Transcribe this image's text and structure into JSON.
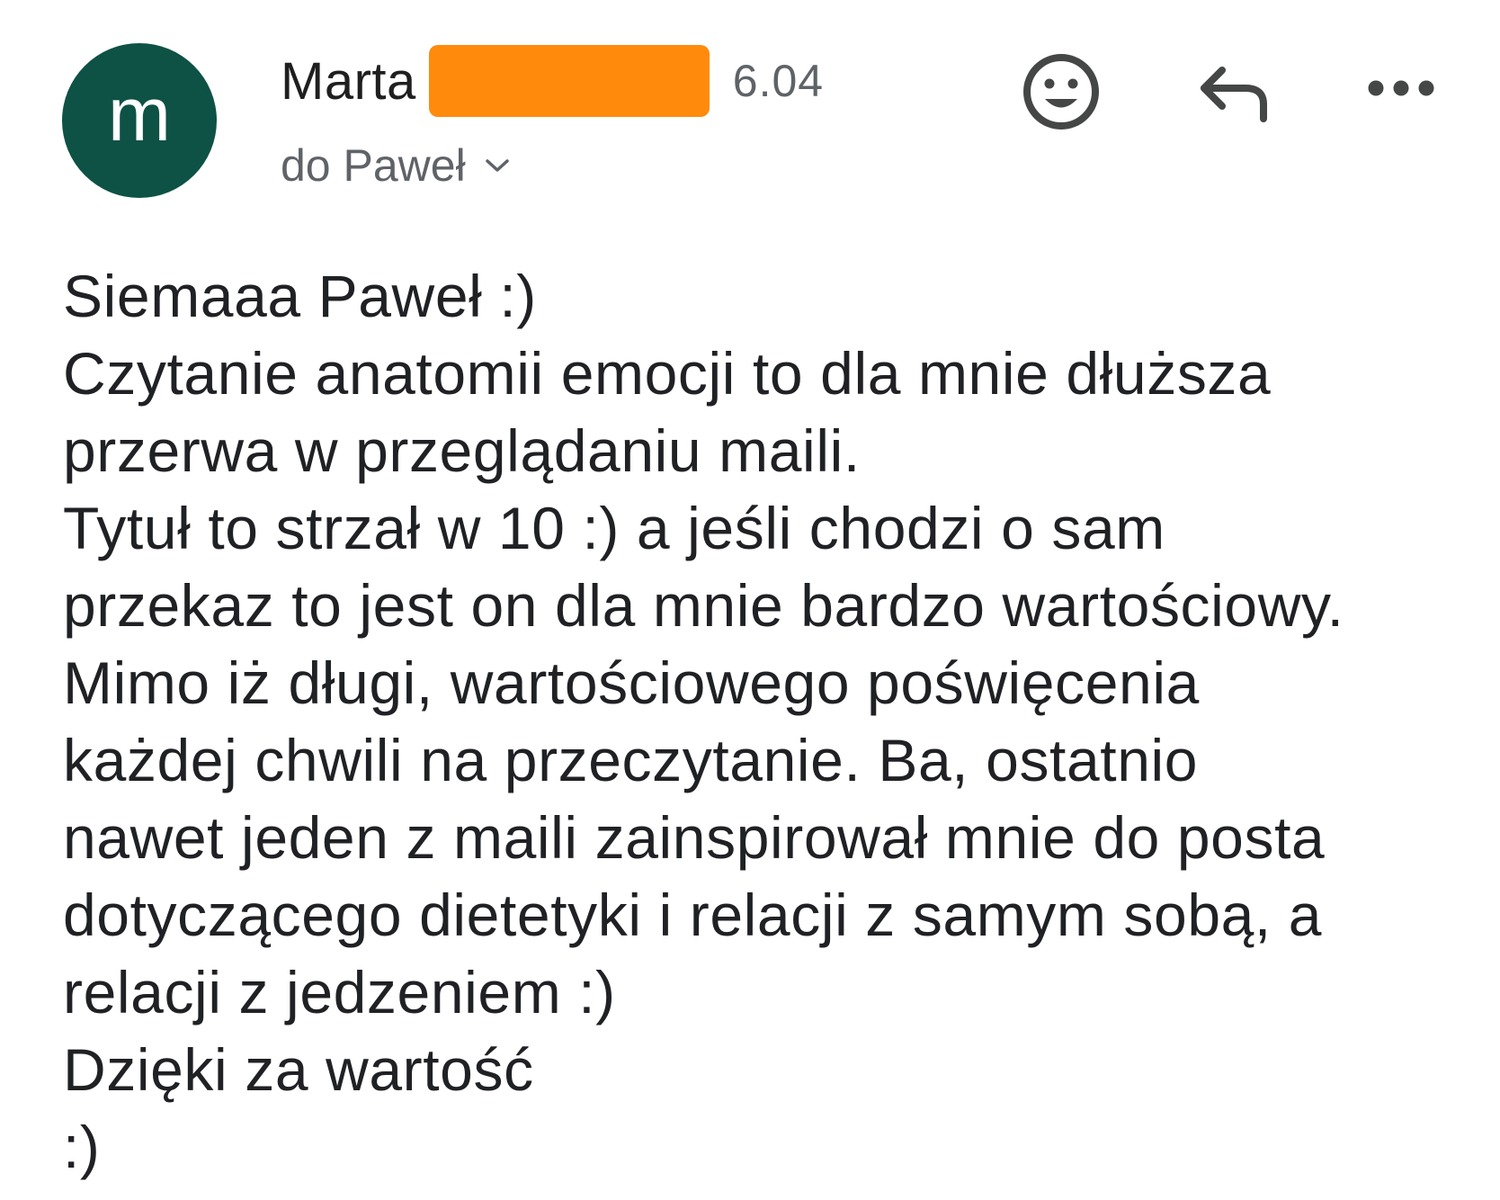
{
  "header": {
    "avatar_letter": "m",
    "avatar_color": "#0e5245",
    "sender_name": "Marta",
    "redaction_color": "#ff8a0c",
    "date": "6.04",
    "recipient_label": "do Paweł",
    "actions": [
      {
        "icon": "smiley-icon"
      },
      {
        "icon": "reply-icon"
      },
      {
        "icon": "more-horizontal-icon"
      }
    ]
  },
  "body": {
    "lines": [
      "Siemaaa Paweł :)",
      "Czytanie anatomii emocji to dla mnie dłuższa",
      "przerwa w przeglądaniu maili.",
      "Tytuł to strzał w 10 :) a jeśli chodzi o sam",
      "przekaz to jest on dla mnie bardzo wartościowy.",
      "Mimo iż długi, wartościowego poświęcenia",
      "każdej chwili na przeczytanie. Ba, ostatnio",
      "nawet jeden z maili zainspirował mnie do posta",
      "dotyczącego dietetyki i relacji z samym sobą, a",
      "relacji z jedzeniem :)",
      "Dzięki za wartość",
      ":)"
    ]
  }
}
